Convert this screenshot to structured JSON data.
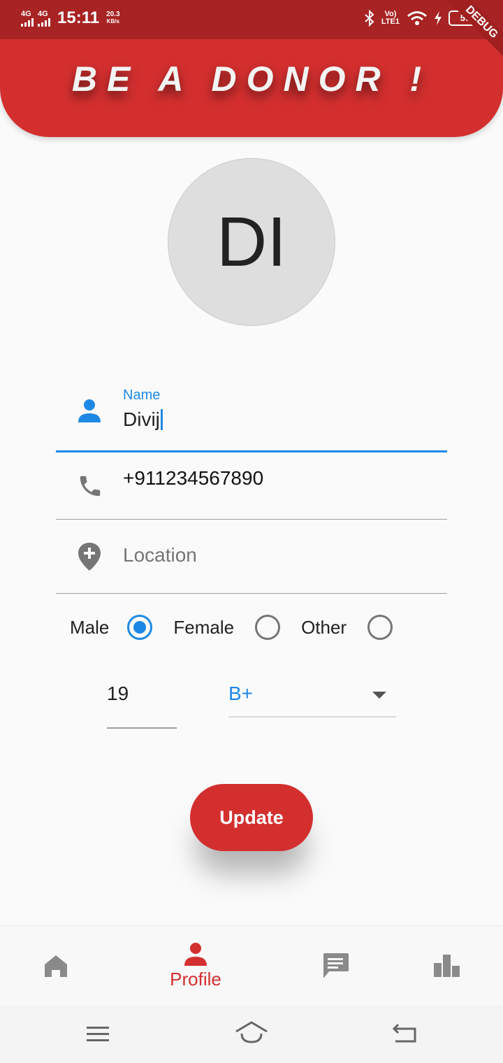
{
  "status_bar": {
    "network_1": "4G",
    "network_2": "4G",
    "time": "15:11",
    "speed_value": "20.3",
    "speed_unit": "KB/s",
    "volte_top": "Vo)",
    "volte_bottom": "LTE1",
    "battery": "59"
  },
  "debug_banner": "DEBUG",
  "header": {
    "title": "BE A DONOR !"
  },
  "avatar": {
    "initials": "DI"
  },
  "form": {
    "name_label": "Name",
    "name_value": "Divij",
    "phone_value": "+911234567890",
    "location_placeholder": "Location",
    "gender_options": [
      "Male",
      "Female",
      "Other"
    ],
    "gender_selected": "Male",
    "age_value": "19",
    "blood_group": "B+",
    "update_label": "Update"
  },
  "bottom_nav": {
    "items": [
      "home-icon",
      "profile-icon",
      "chat-icon",
      "stats-icon"
    ],
    "active": "Profile"
  },
  "colors": {
    "primary_red": "#d32f2f",
    "status_bar": "#a82323",
    "accent_blue": "#1e88e5"
  }
}
